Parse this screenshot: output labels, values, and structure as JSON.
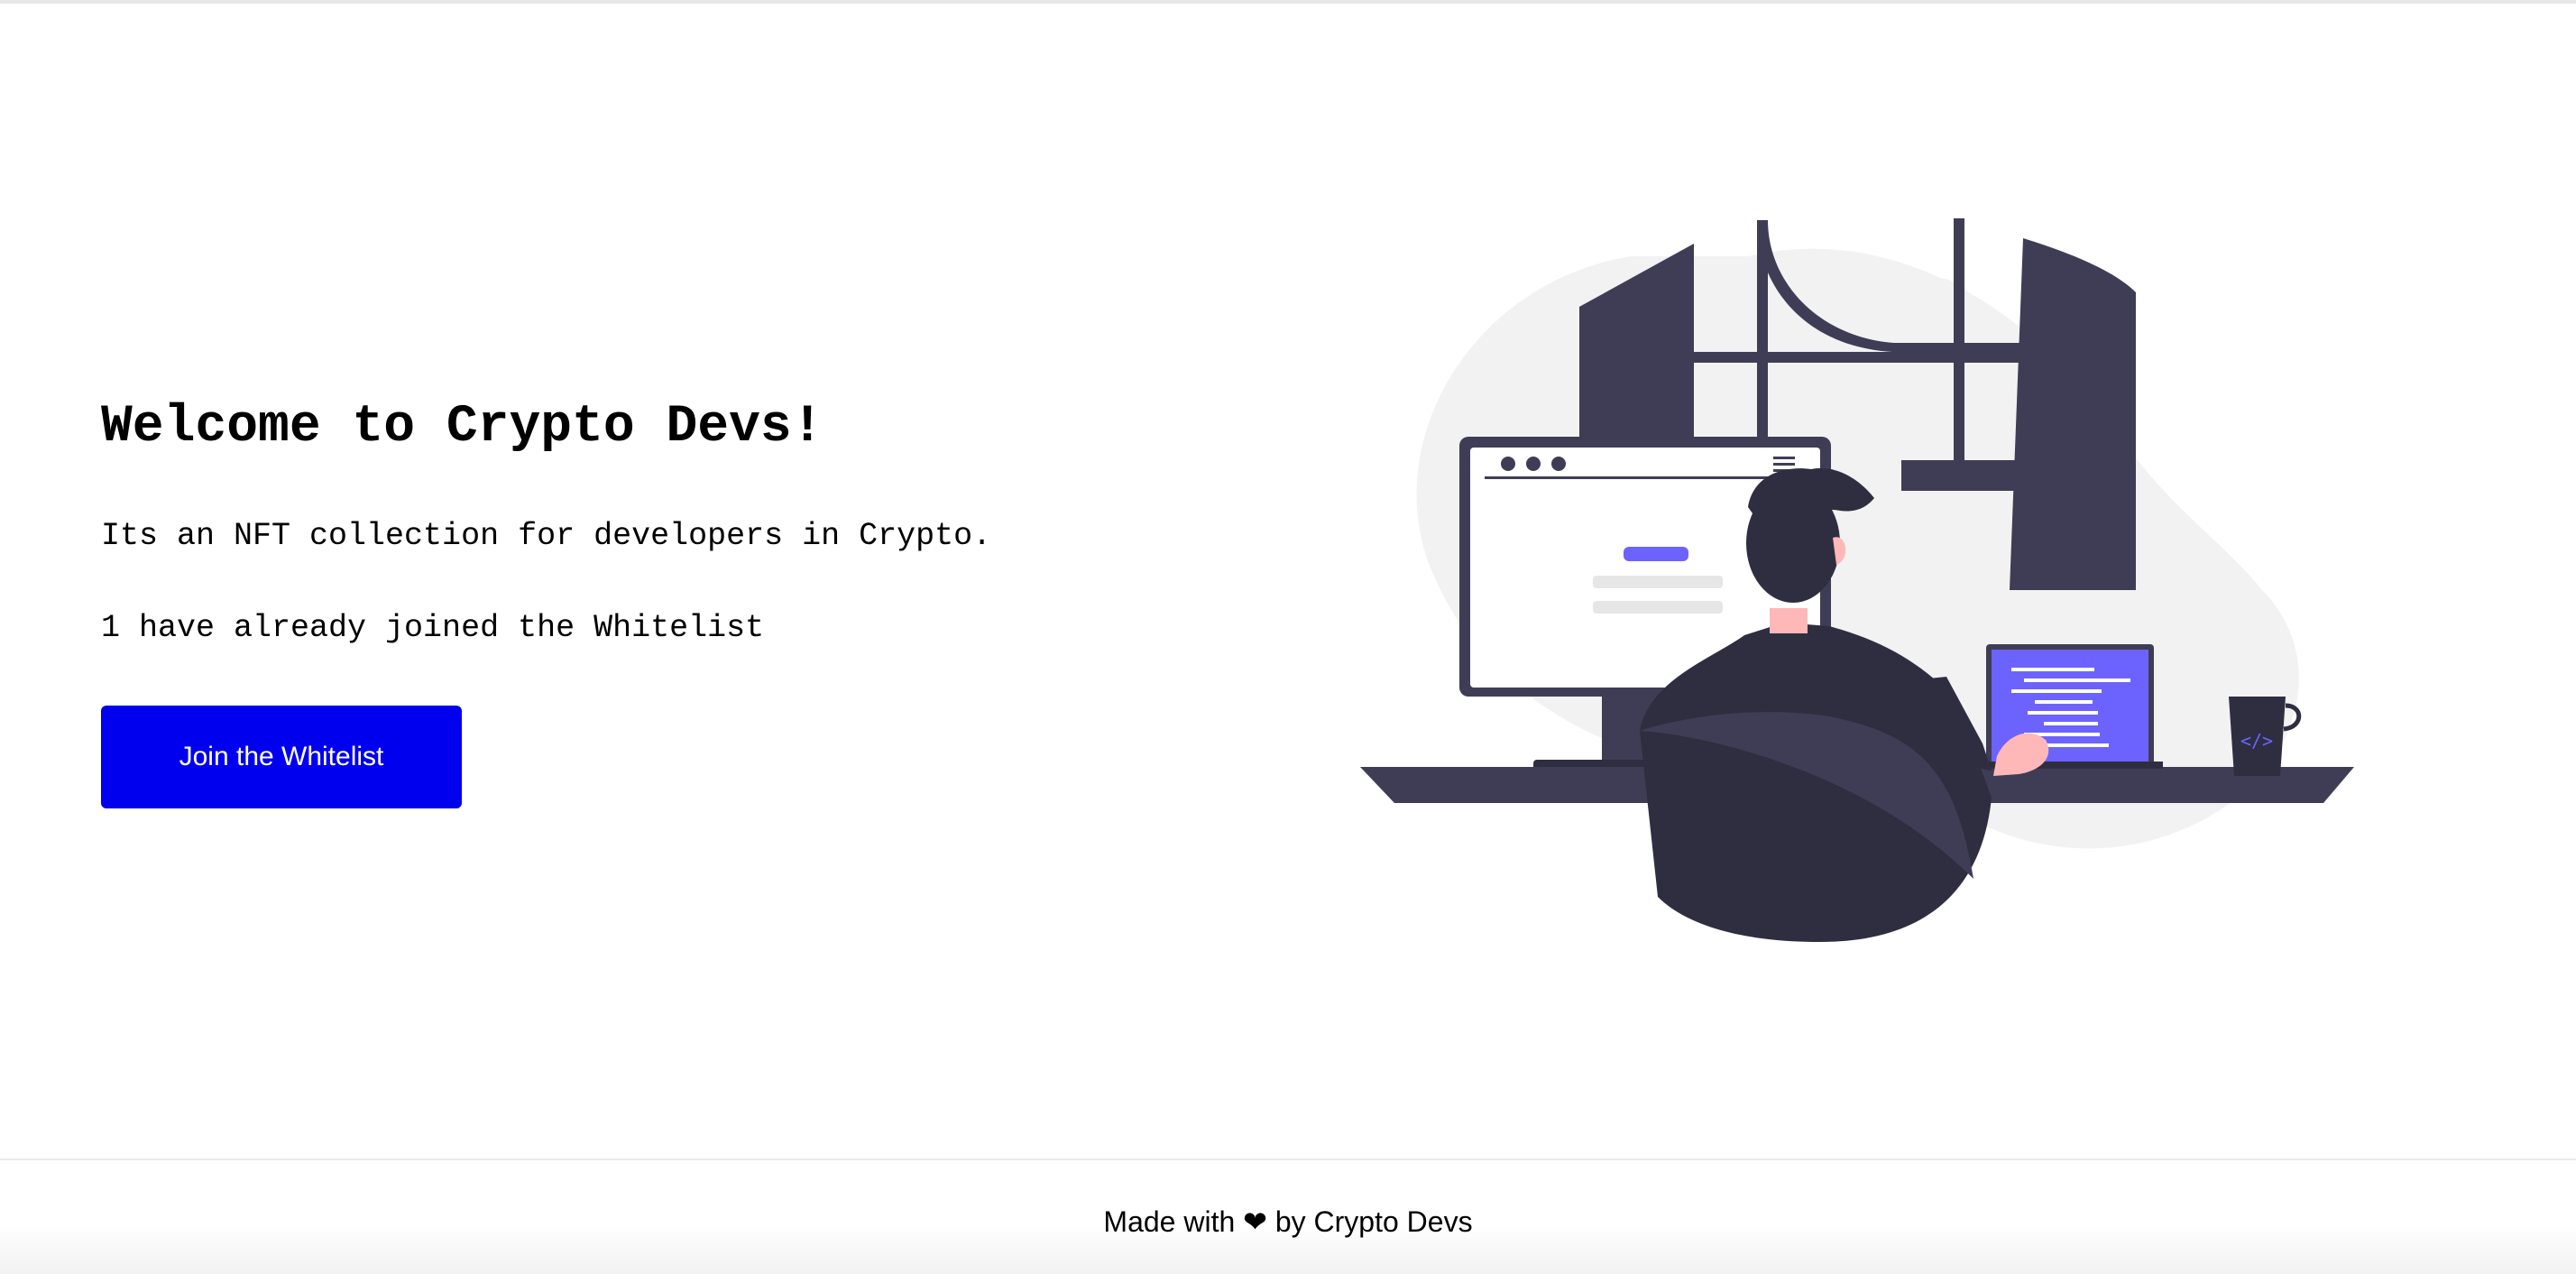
{
  "hero": {
    "title": "Welcome to Crypto Devs!",
    "description": "Its an NFT collection for developers in Crypto.",
    "joined_text": "1 have already joined the Whitelist",
    "join_button_label": "Join the Whitelist"
  },
  "illustration": {
    "monitor_icon_name": "browser-window",
    "mug_code_symbol": "</>"
  },
  "footer": {
    "text": "Made with ❤ by Crypto Devs"
  },
  "colors": {
    "button": "#0000ee",
    "illustration_dark": "#3f3d56",
    "illustration_accent": "#6c63ff"
  }
}
